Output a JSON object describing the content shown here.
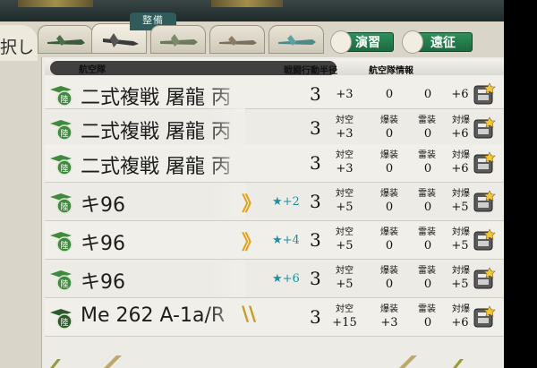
{
  "top": {
    "panel_tab": "整備",
    "left_kanji": "択し",
    "btn_practice": "演習",
    "btn_expedition": "遠征"
  },
  "header": {
    "corps": "航空隊",
    "range": "戦闘行動半径",
    "info": "航空隊情報"
  },
  "stat_labels": [
    "対空",
    "爆装",
    "雷装",
    "対爆"
  ],
  "rows": [
    {
      "name": "二式複戦 屠龍 丙",
      "rank": "",
      "stars": "",
      "range": "3",
      "stats": [
        "+3",
        "0",
        "0",
        "+6"
      ],
      "emblem": "land-fighter"
    },
    {
      "name": "二式複戦 屠龍 丙",
      "rank": "",
      "stars": "",
      "range": "3",
      "stats": [
        "+3",
        "0",
        "0",
        "+6"
      ],
      "emblem": "land-fighter"
    },
    {
      "name": "二式複戦 屠龍 丙",
      "rank": "",
      "stars": "",
      "range": "3",
      "stats": [
        "+3",
        "0",
        "0",
        "+6"
      ],
      "emblem": "land-fighter"
    },
    {
      "name": "キ96",
      "rank": "》",
      "stars": "★+2",
      "range": "3",
      "stats": [
        "+5",
        "0",
        "0",
        "+5"
      ],
      "emblem": "land-fighter"
    },
    {
      "name": "キ96",
      "rank": "》",
      "stars": "★+4",
      "range": "3",
      "stats": [
        "+5",
        "0",
        "0",
        "+5"
      ],
      "emblem": "land-fighter"
    },
    {
      "name": "キ96",
      "rank": "",
      "stars": "★+6",
      "range": "3",
      "stats": [
        "+5",
        "0",
        "0",
        "+5"
      ],
      "emblem": "land-fighter"
    },
    {
      "name": "Me 262 A-1a/R",
      "rank": "\\\\",
      "stars": "",
      "range": "3",
      "stats": [
        "+15",
        "+3",
        "0",
        "+6"
      ],
      "emblem": "jet-fighter"
    }
  ]
}
